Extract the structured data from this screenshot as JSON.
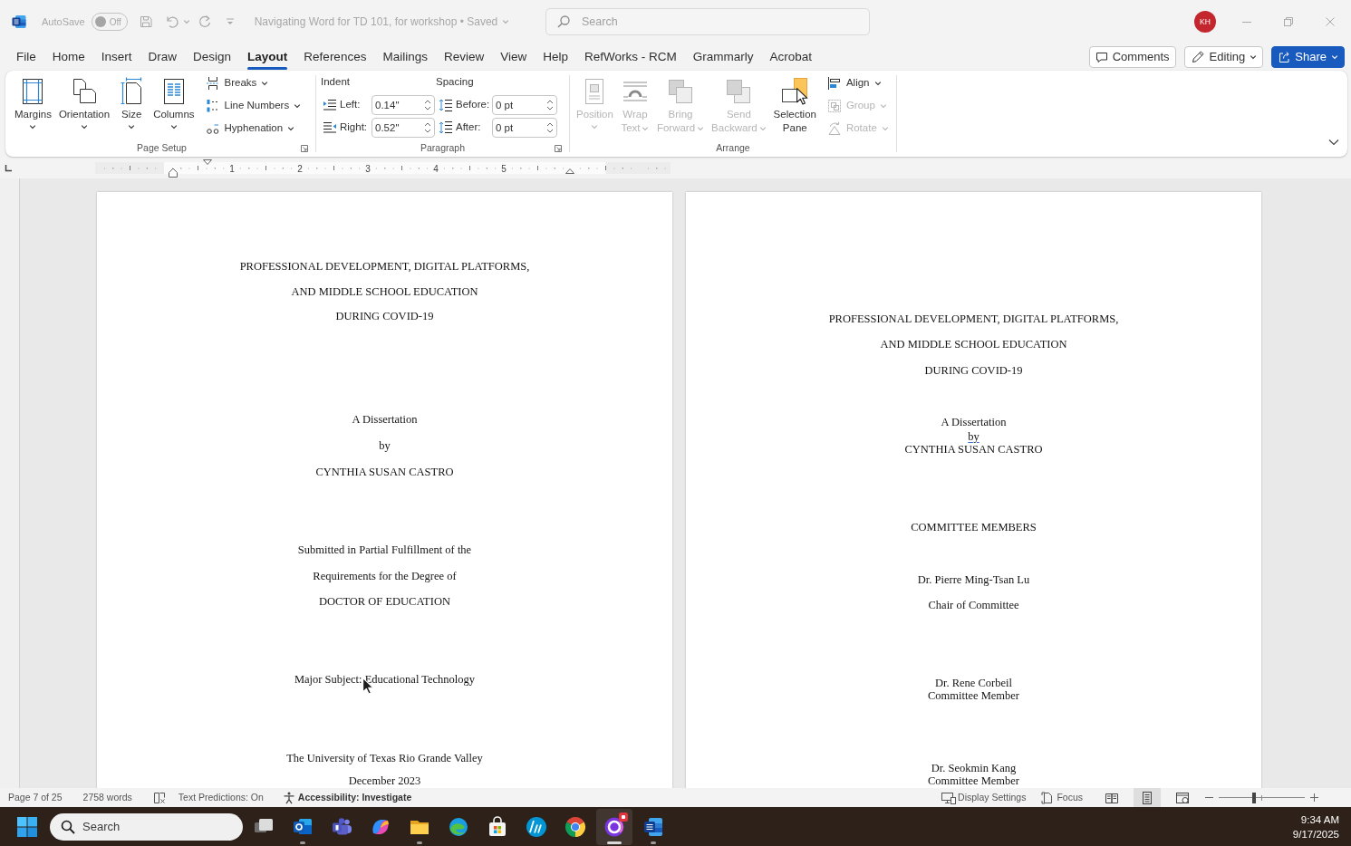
{
  "title_bar": {
    "autosave": {
      "label": "AutoSave",
      "toggle_label": "Off",
      "on": false
    },
    "document_title": "Navigating Word for TD 101, for workshop • Saved",
    "search": {
      "placeholder": "Search"
    },
    "account": {
      "initials": "KH"
    }
  },
  "menu_tabs": [
    {
      "label": "File",
      "selected": false
    },
    {
      "label": "Home",
      "selected": false
    },
    {
      "label": "Insert",
      "selected": false
    },
    {
      "label": "Draw",
      "selected": false
    },
    {
      "label": "Design",
      "selected": false
    },
    {
      "label": "Layout",
      "selected": true
    },
    {
      "label": "References",
      "selected": false
    },
    {
      "label": "Mailings",
      "selected": false
    },
    {
      "label": "Review",
      "selected": false
    },
    {
      "label": "View",
      "selected": false
    },
    {
      "label": "Help",
      "selected": false
    },
    {
      "label": "RefWorks - RCM",
      "selected": false
    },
    {
      "label": "Grammarly",
      "selected": false
    },
    {
      "label": "Acrobat",
      "selected": false
    }
  ],
  "header_buttons": [
    {
      "kind": "comments",
      "label": "Comments"
    },
    {
      "kind": "editing",
      "label": "Editing"
    },
    {
      "kind": "share",
      "label": "Share"
    }
  ],
  "ribbon": {
    "groups": [
      {
        "kind": "page_setup",
        "title": "Page Setup",
        "dialog_launcher": true,
        "large_buttons": [
          {
            "label": "Margins",
            "dropdown": true,
            "disabled": false
          },
          {
            "label": "Orientation",
            "dropdown": true,
            "disabled": false
          },
          {
            "label": "Size",
            "dropdown": true,
            "disabled": false
          },
          {
            "label": "Columns",
            "dropdown": true,
            "disabled": false
          }
        ],
        "small_buttons": [
          {
            "label": "Breaks",
            "dropdown": true,
            "disabled": false
          },
          {
            "label": "Line Numbers",
            "dropdown": true,
            "disabled": false
          },
          {
            "label": "Hyphenation",
            "dropdown": true,
            "disabled": false
          }
        ]
      },
      {
        "kind": "paragraph",
        "title": "Paragraph",
        "dialog_launcher": true,
        "columns": [
          {
            "heading": "Indent",
            "fields": [
              {
                "label": "Left:",
                "value": "0.14\""
              },
              {
                "label": "Right:",
                "value": "0.52\""
              }
            ]
          },
          {
            "heading": "Spacing",
            "fields": [
              {
                "label": "Before:",
                "value": "0 pt"
              },
              {
                "label": "After:",
                "value": "0 pt"
              }
            ]
          }
        ]
      },
      {
        "kind": "arrange",
        "title": "Arrange",
        "dialog_launcher": false,
        "large_buttons": [
          {
            "label": "Position",
            "dropdown": true,
            "disabled": true
          },
          {
            "label": "Wrap Text",
            "dropdown": true,
            "disabled": true
          },
          {
            "label": "Bring Forward",
            "dropdown": true,
            "disabled": true
          },
          {
            "label": "Send Backward",
            "dropdown": true,
            "disabled": true
          },
          {
            "label": "Selection Pane",
            "dropdown": false,
            "disabled": false
          }
        ],
        "small_buttons": [
          {
            "label": "Align",
            "dropdown": true,
            "disabled": false
          },
          {
            "label": "Group",
            "dropdown": true,
            "disabled": true
          },
          {
            "label": "Rotate",
            "dropdown": true,
            "disabled": true
          }
        ]
      }
    ]
  },
  "ruler": {
    "numbers": [
      "1",
      "2",
      "3",
      "4",
      "5"
    ]
  },
  "pages": [
    {
      "lines": [
        {
          "text": "PROFESSIONAL DEVELOPMENT, DIGITAL PLATFORMS,",
          "flagged": false
        },
        {
          "text": "AND MIDDLE SCHOOL EDUCATION",
          "flagged": false
        },
        {
          "text": "DURING COVID-19",
          "flagged": false
        },
        {
          "text": "A Dissertation",
          "flagged": false
        },
        {
          "text": "by",
          "flagged": false
        },
        {
          "text": "CYNTHIA SUSAN CASTRO",
          "flagged": false
        },
        {
          "text": "Submitted in Partial Fulfillment of the",
          "flagged": false
        },
        {
          "text": "Requirements for the Degree of",
          "flagged": false
        },
        {
          "text": "DOCTOR OF EDUCATION",
          "flagged": false
        },
        {
          "text": "Major Subject: Educational Technology",
          "flagged": false
        },
        {
          "text": "The University of Texas Rio Grande Valley",
          "flagged": false
        },
        {
          "text": "December 2023",
          "flagged": false
        }
      ]
    },
    {
      "lines": [
        {
          "text": "PROFESSIONAL DEVELOPMENT, DIGITAL PLATFORMS,",
          "flagged": false
        },
        {
          "text": "AND MIDDLE SCHOOL EDUCATION",
          "flagged": false
        },
        {
          "text": "DURING COVID-19",
          "flagged": false
        },
        {
          "text": "A Dissertation",
          "flagged": false
        },
        {
          "text": "by",
          "flagged": true
        },
        {
          "text": "CYNTHIA SUSAN CASTRO",
          "flagged": false
        },
        {
          "text": "COMMITTEE MEMBERS",
          "flagged": false
        },
        {
          "text": "Dr. Pierre Ming-Tsan Lu",
          "flagged": false
        },
        {
          "text": "Chair of Committee",
          "flagged": false
        },
        {
          "text": "Dr. Rene Corbeil",
          "flagged": false
        },
        {
          "text": "Committee Member",
          "flagged": false
        },
        {
          "text": "Dr. Seokmin Kang",
          "flagged": false
        },
        {
          "text": "Committee Member",
          "flagged": false
        }
      ]
    }
  ],
  "status_bar": {
    "page_info": "Page 7 of 25",
    "word_count": "2758 words",
    "text_predictions": "Text Predictions: On",
    "accessibility": "Accessibility: Investigate",
    "display_settings": "Display Settings",
    "focus": "Focus",
    "view_buttons": [
      {
        "selected": false
      },
      {
        "selected": true
      },
      {
        "selected": false
      }
    ],
    "zoom_slider": {
      "level": 0.41
    }
  },
  "taskbar": {
    "search": {
      "placeholder": "Search"
    },
    "apps": [
      {
        "running": false,
        "active": false,
        "notification": false
      },
      {
        "running": true,
        "active": false,
        "notification": false
      },
      {
        "running": false,
        "active": false,
        "notification": false
      },
      {
        "running": false,
        "active": false,
        "notification": false
      },
      {
        "running": true,
        "active": false,
        "notification": false
      },
      {
        "running": false,
        "active": false,
        "notification": false
      },
      {
        "running": false,
        "active": false,
        "notification": false
      },
      {
        "running": false,
        "active": false,
        "notification": false
      },
      {
        "running": false,
        "active": false,
        "notification": false
      },
      {
        "running": true,
        "active": true,
        "notification": true
      },
      {
        "running": true,
        "active": false,
        "notification": false
      }
    ],
    "time": "9:34 AM",
    "date": "9/17/2025"
  }
}
